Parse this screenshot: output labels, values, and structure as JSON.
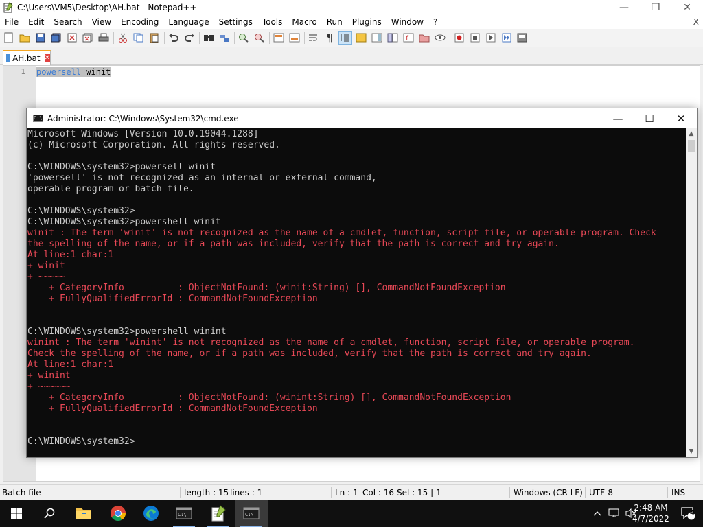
{
  "npp": {
    "title": "C:\\Users\\VM5\\Desktop\\AH.bat - Notepad++",
    "menu": [
      "File",
      "Edit",
      "Search",
      "View",
      "Encoding",
      "Language",
      "Settings",
      "Tools",
      "Macro",
      "Run",
      "Plugins",
      "Window",
      "?"
    ],
    "menu_close": "X",
    "tab_label": "AH.bat",
    "line_number": "1",
    "code_kw": "powersell",
    "code_rest": " winit",
    "status": {
      "type": "Batch file",
      "length": "length : 15",
      "lines": "lines : 1",
      "ln": "Ln : 1",
      "col": "Col : 16",
      "sel": "Sel : 15 | 1",
      "eol": "Windows (CR LF)",
      "encoding": "UTF-8",
      "mode": "INS"
    }
  },
  "cmd": {
    "title": "Administrator: C:\\Windows\\System32\\cmd.exe",
    "lines": [
      {
        "t": "Microsoft Windows [Version 10.0.19044.1288]",
        "c": "w"
      },
      {
        "t": "(c) Microsoft Corporation. All rights reserved.",
        "c": "w"
      },
      {
        "t": "",
        "c": "w"
      },
      {
        "t": "C:\\WINDOWS\\system32>powersell winit",
        "c": "w"
      },
      {
        "t": "'powersell' is not recognized as an internal or external command,",
        "c": "w"
      },
      {
        "t": "operable program or batch file.",
        "c": "w"
      },
      {
        "t": "",
        "c": "w"
      },
      {
        "t": "C:\\WINDOWS\\system32>",
        "c": "w"
      },
      {
        "t": "C:\\WINDOWS\\system32>powershell winit",
        "c": "w"
      },
      {
        "t": "winit : The term 'winit' is not recognized as the name of a cmdlet, function, script file, or operable program. Check",
        "c": "r"
      },
      {
        "t": "the spelling of the name, or if a path was included, verify that the path is correct and try again.",
        "c": "r"
      },
      {
        "t": "At line:1 char:1",
        "c": "r"
      },
      {
        "t": "+ winit",
        "c": "r"
      },
      {
        "t": "+ ~~~~~",
        "c": "r"
      },
      {
        "t": "    + CategoryInfo          : ObjectNotFound: (winit:String) [], CommandNotFoundException",
        "c": "r"
      },
      {
        "t": "    + FullyQualifiedErrorId : CommandNotFoundException",
        "c": "r"
      },
      {
        "t": "",
        "c": "w"
      },
      {
        "t": "",
        "c": "w"
      },
      {
        "t": "C:\\WINDOWS\\system32>powershell winint",
        "c": "w"
      },
      {
        "t": "winint : The term 'winint' is not recognized as the name of a cmdlet, function, script file, or operable program.",
        "c": "r"
      },
      {
        "t": "Check the spelling of the name, or if a path was included, verify that the path is correct and try again.",
        "c": "r"
      },
      {
        "t": "At line:1 char:1",
        "c": "r"
      },
      {
        "t": "+ winint",
        "c": "r"
      },
      {
        "t": "+ ~~~~~~",
        "c": "r"
      },
      {
        "t": "    + CategoryInfo          : ObjectNotFound: (winint:String) [], CommandNotFoundException",
        "c": "r"
      },
      {
        "t": "    + FullyQualifiedErrorId : CommandNotFoundException",
        "c": "r"
      },
      {
        "t": "",
        "c": "w"
      },
      {
        "t": "",
        "c": "w"
      },
      {
        "t": "C:\\WINDOWS\\system32>",
        "c": "w"
      }
    ]
  },
  "taskbar": {
    "time": "2:48 AM",
    "date": "4/7/2022",
    "notifications": "4"
  },
  "colors": {
    "console_bg": "#0c0c0c",
    "console_text": "#cccccc",
    "console_error": "#e74856",
    "taskbar_bg": "#101010"
  }
}
